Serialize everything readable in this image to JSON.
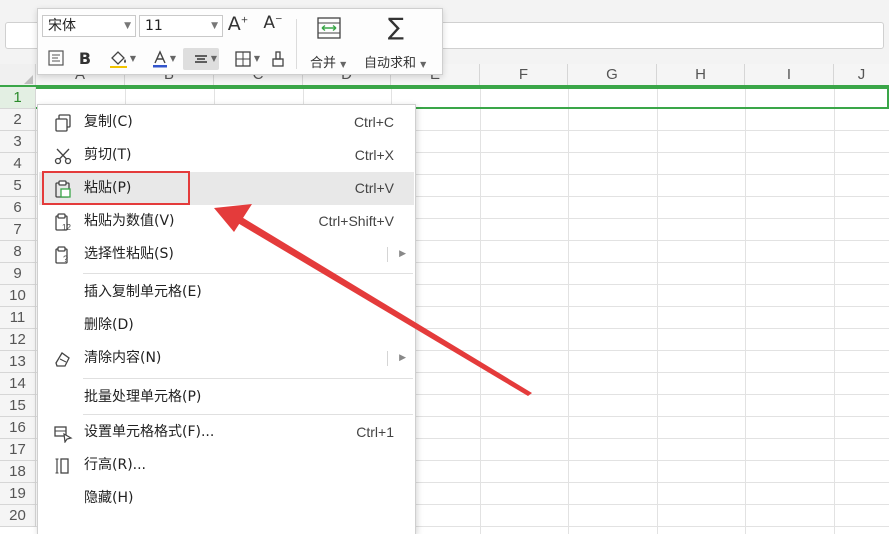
{
  "toolbar": {
    "font_name": "宋体",
    "font_size": "11",
    "increase_font_label": "A",
    "decrease_font_label": "A",
    "bold_label": "B",
    "merge_label": "合并",
    "autosum_label": "自动求和",
    "autosum_glyph": "∑"
  },
  "columns": [
    "A",
    "B",
    "C",
    "D",
    "E",
    "F",
    "G",
    "H",
    "I",
    "J"
  ],
  "rows": [
    "1",
    "2",
    "3",
    "4",
    "5",
    "6",
    "7",
    "8",
    "9",
    "10",
    "11",
    "12",
    "13",
    "14",
    "15",
    "16",
    "17",
    "18",
    "19",
    "20"
  ],
  "context_menu": {
    "items": [
      {
        "label": "复制(C)",
        "shortcut": "Ctrl+C",
        "icon": "copy-icon"
      },
      {
        "label": "剪切(T)",
        "shortcut": "Ctrl+X",
        "icon": "scissors-icon"
      },
      {
        "label": "粘贴(P)",
        "shortcut": "Ctrl+V",
        "icon": "paste-icon"
      },
      {
        "label": "粘贴为数值(V)",
        "shortcut": "Ctrl+Shift+V",
        "icon": "paste-values-icon"
      },
      {
        "label": "选择性粘贴(S)",
        "shortcut": "",
        "icon": "paste-special-icon"
      },
      {
        "label": "插入复制单元格(E)",
        "shortcut": "",
        "icon": ""
      },
      {
        "label": "删除(D)",
        "shortcut": "",
        "icon": ""
      },
      {
        "label": "清除内容(N)",
        "shortcut": "",
        "icon": "eraser-icon"
      },
      {
        "label": "批量处理单元格(P)",
        "shortcut": "",
        "icon": ""
      },
      {
        "label": "设置单元格格式(F)...",
        "shortcut": "Ctrl+1",
        "icon": "format-cells-icon"
      },
      {
        "label": "行高(R)...",
        "shortcut": "",
        "icon": "row-height-icon"
      },
      {
        "label": "隐藏(H)",
        "shortcut": "",
        "icon": ""
      }
    ]
  },
  "colors": {
    "selection": "#3aa648",
    "annotation": "#e43b3b"
  }
}
